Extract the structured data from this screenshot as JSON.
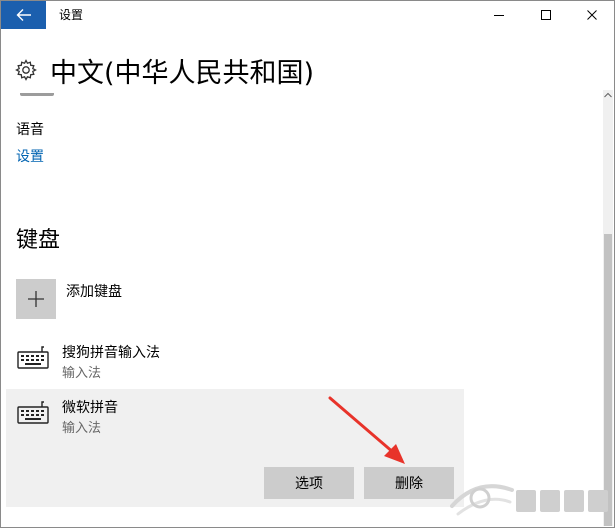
{
  "window": {
    "title": "设置"
  },
  "header": {
    "title": "中文(中华人民共和国)"
  },
  "speech": {
    "label": "语音",
    "settings_link": "设置"
  },
  "keyboard": {
    "section_title": "键盘",
    "add_label": "添加键盘",
    "items": [
      {
        "name": "搜狗拼音输入法",
        "type": "输入法"
      },
      {
        "name": "微软拼音",
        "type": "输入法",
        "options_label": "选项",
        "delete_label": "删除"
      }
    ]
  },
  "colors": {
    "accent": "#1b5fae",
    "link": "#0063b1",
    "button": "#cccccc",
    "selected_bg": "#f0f0f0",
    "annotation": "#e8332a"
  },
  "icons": [
    "back-arrow-icon",
    "minimize-icon",
    "maximize-icon",
    "close-icon",
    "gear-icon",
    "plus-icon",
    "keyboard-icon",
    "chevron-up-icon"
  ]
}
